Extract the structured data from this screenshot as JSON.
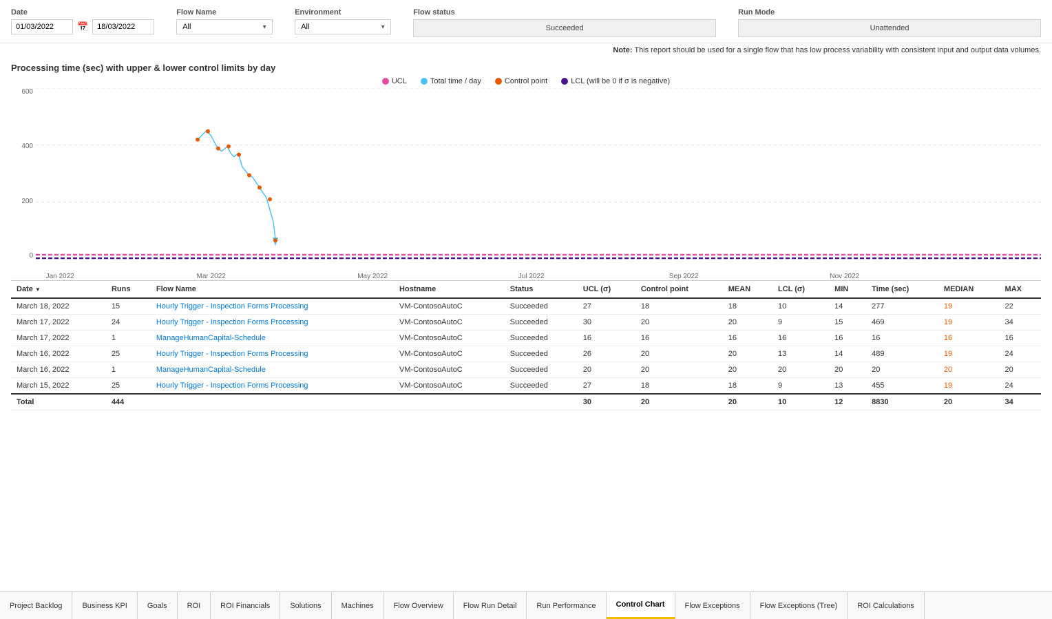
{
  "filters": {
    "date_label": "Date",
    "date_from": "01/03/2022",
    "date_to": "18/03/2022",
    "flow_name_label": "Flow Name",
    "flow_name_value": "All",
    "environment_label": "Environment",
    "environment_value": "All",
    "flow_status_label": "Flow status",
    "flow_status_value": "Succeeded",
    "run_mode_label": "Run Mode",
    "run_mode_value": "Unattended"
  },
  "note": "Note:",
  "note_text": "This report should be used for a single flow that has low process variability with consistent input and output data volumes.",
  "chart": {
    "title": "Processing time (sec) with upper & lower control limits by day",
    "legend": [
      {
        "key": "ucl",
        "label": "UCL",
        "color": "#e94da1"
      },
      {
        "key": "total_time",
        "label": "Total time / day",
        "color": "#4fc3f7"
      },
      {
        "key": "control_point",
        "label": "Control point",
        "color": "#e55c00"
      },
      {
        "key": "lcl",
        "label": "LCL (will be 0 if σ is negative)",
        "color": "#4a148c"
      }
    ],
    "y_labels": [
      "600",
      "400",
      "200",
      "0"
    ],
    "x_labels": [
      {
        "text": "Jan 2022",
        "pct": 2
      },
      {
        "text": "Mar 2022",
        "pct": 16
      },
      {
        "text": "May 2022",
        "pct": 32
      },
      {
        "text": "Jul 2022",
        "pct": 48
      },
      {
        "text": "Sep 2022",
        "pct": 64
      },
      {
        "text": "Nov 2022",
        "pct": 80
      }
    ]
  },
  "table": {
    "headers": [
      "Date",
      "Runs",
      "Flow Name",
      "Hostname",
      "Status",
      "UCL (σ)",
      "Control point",
      "MEAN",
      "LCL (σ)",
      "MIN",
      "Time (sec)",
      "MEDIAN",
      "MAX"
    ],
    "rows": [
      {
        "date": "March 18, 2022",
        "runs": "15",
        "flow_name": "Hourly Trigger - Inspection Forms Processing",
        "hostname": "VM-ContosoAutoC",
        "status": "Succeeded",
        "ucl": "27",
        "control_point": "18",
        "mean": "18",
        "lcl": "10",
        "min": "14",
        "time_sec": "277",
        "median": "19",
        "max": "22"
      },
      {
        "date": "March 17, 2022",
        "runs": "24",
        "flow_name": "Hourly Trigger - Inspection Forms Processing",
        "hostname": "VM-ContosoAutoC",
        "status": "Succeeded",
        "ucl": "30",
        "control_point": "20",
        "mean": "20",
        "lcl": "9",
        "min": "15",
        "time_sec": "469",
        "median": "19",
        "max": "34"
      },
      {
        "date": "March 17, 2022",
        "runs": "1",
        "flow_name": "ManageHumanCapital-Schedule",
        "hostname": "VM-ContosoAutoC",
        "status": "Succeeded",
        "ucl": "16",
        "control_point": "16",
        "mean": "16",
        "lcl": "16",
        "min": "16",
        "time_sec": "16",
        "median": "16",
        "max": "16"
      },
      {
        "date": "March 16, 2022",
        "runs": "25",
        "flow_name": "Hourly Trigger - Inspection Forms Processing",
        "hostname": "VM-ContosoAutoC",
        "status": "Succeeded",
        "ucl": "26",
        "control_point": "20",
        "mean": "20",
        "lcl": "13",
        "min": "14",
        "time_sec": "489",
        "median": "19",
        "max": "24"
      },
      {
        "date": "March 16, 2022",
        "runs": "1",
        "flow_name": "ManageHumanCapital-Schedule",
        "hostname": "VM-ContosoAutoC",
        "status": "Succeeded",
        "ucl": "20",
        "control_point": "20",
        "mean": "20",
        "lcl": "20",
        "min": "20",
        "time_sec": "20",
        "median": "20",
        "max": "20"
      },
      {
        "date": "March 15, 2022",
        "runs": "25",
        "flow_name": "Hourly Trigger - Inspection Forms Processing",
        "hostname": "VM-ContosoAutoC",
        "status": "Succeeded",
        "ucl": "27",
        "control_point": "18",
        "mean": "18",
        "lcl": "9",
        "min": "13",
        "time_sec": "455",
        "median": "19",
        "max": "24"
      }
    ],
    "total": {
      "label": "Total",
      "runs": "444",
      "ucl": "30",
      "control_point": "20",
      "mean": "20",
      "lcl": "10",
      "min": "12",
      "time_sec": "8830",
      "median": "20",
      "max": "34"
    }
  },
  "tabs": [
    {
      "key": "project-backlog",
      "label": "Project Backlog",
      "active": false
    },
    {
      "key": "business-kpi",
      "label": "Business KPI",
      "active": false
    },
    {
      "key": "goals",
      "label": "Goals",
      "active": false
    },
    {
      "key": "roi",
      "label": "ROI",
      "active": false
    },
    {
      "key": "roi-financials",
      "label": "ROI Financials",
      "active": false
    },
    {
      "key": "solutions",
      "label": "Solutions",
      "active": false
    },
    {
      "key": "machines",
      "label": "Machines",
      "active": false
    },
    {
      "key": "flow-overview",
      "label": "Flow Overview",
      "active": false
    },
    {
      "key": "flow-run-detail",
      "label": "Flow Run Detail",
      "active": false
    },
    {
      "key": "run-performance",
      "label": "Run Performance",
      "active": false
    },
    {
      "key": "control-chart",
      "label": "Control Chart",
      "active": true
    },
    {
      "key": "flow-exceptions",
      "label": "Flow Exceptions",
      "active": false
    },
    {
      "key": "flow-exceptions-tree",
      "label": "Flow Exceptions (Tree)",
      "active": false
    },
    {
      "key": "roi-calculations",
      "label": "ROI Calculations",
      "active": false
    }
  ]
}
